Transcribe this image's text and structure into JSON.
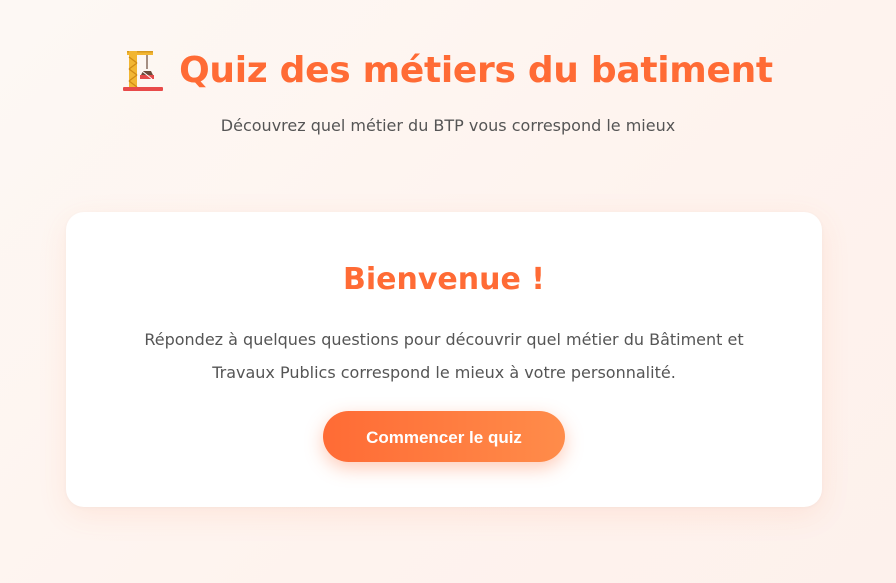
{
  "header": {
    "icon": "construction-crane-icon",
    "title": "Quiz des métiers du batiment",
    "subtitle": "Découvrez quel métier du BTP vous correspond le mieux"
  },
  "welcome_card": {
    "title": "Bienvenue !",
    "text": "Répondez à quelques questions pour découvrir quel métier du Bâtiment et Travaux Publics correspond le mieux à votre personnalité.",
    "start_button_label": "Commencer le quiz"
  },
  "colors": {
    "accent": "#ff6b35",
    "accent_light": "#ff8c4a",
    "text": "#555555",
    "card_background": "#ffffff",
    "page_background": "#fdf5f0"
  }
}
